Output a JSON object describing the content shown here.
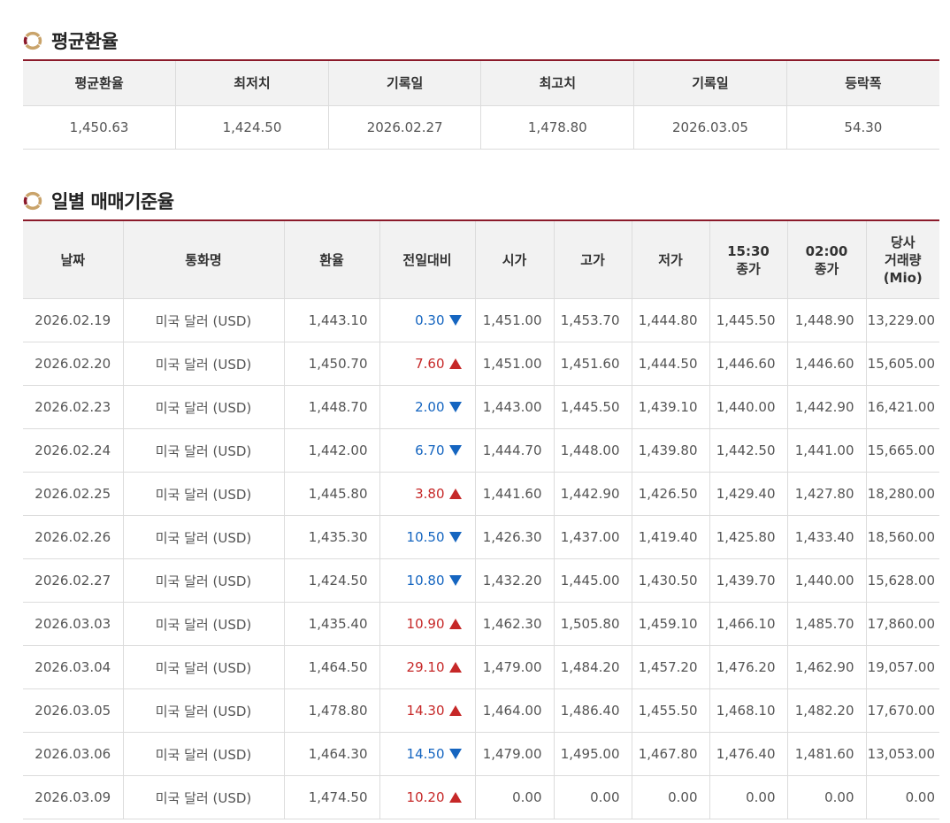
{
  "avg_section": {
    "title": "평균환율",
    "headers": [
      "평균환율",
      "최저치",
      "기록일",
      "최고치",
      "기록일",
      "등락폭"
    ],
    "values": [
      "1,450.63",
      "1,424.50",
      "2026.02.27",
      "1,478.80",
      "2026.03.05",
      "54.30"
    ]
  },
  "daily_section": {
    "title": "일별 매매기준율",
    "headers": [
      "날짜",
      "통화명",
      "환율",
      "전일대비",
      "시가",
      "고가",
      "저가",
      "15:30\n종가",
      "02:00\n종가",
      "당사\n거래량\n(Mio)"
    ],
    "rows": [
      {
        "date": "2026.02.19",
        "currency": "미국 달러 (USD)",
        "rate": "1,443.10",
        "change": "0.30",
        "dir": "down",
        "open": "1,451.00",
        "high": "1,453.70",
        "low": "1,444.80",
        "close1530": "1,445.50",
        "close0200": "1,448.90",
        "volume": "13,229.00"
      },
      {
        "date": "2026.02.20",
        "currency": "미국 달러 (USD)",
        "rate": "1,450.70",
        "change": "7.60",
        "dir": "up",
        "open": "1,451.00",
        "high": "1,451.60",
        "low": "1,444.50",
        "close1530": "1,446.60",
        "close0200": "1,446.60",
        "volume": "15,605.00"
      },
      {
        "date": "2026.02.23",
        "currency": "미국 달러 (USD)",
        "rate": "1,448.70",
        "change": "2.00",
        "dir": "down",
        "open": "1,443.00",
        "high": "1,445.50",
        "low": "1,439.10",
        "close1530": "1,440.00",
        "close0200": "1,442.90",
        "volume": "16,421.00"
      },
      {
        "date": "2026.02.24",
        "currency": "미국 달러 (USD)",
        "rate": "1,442.00",
        "change": "6.70",
        "dir": "down",
        "open": "1,444.70",
        "high": "1,448.00",
        "low": "1,439.80",
        "close1530": "1,442.50",
        "close0200": "1,441.00",
        "volume": "15,665.00"
      },
      {
        "date": "2026.02.25",
        "currency": "미국 달러 (USD)",
        "rate": "1,445.80",
        "change": "3.80",
        "dir": "up",
        "open": "1,441.60",
        "high": "1,442.90",
        "low": "1,426.50",
        "close1530": "1,429.40",
        "close0200": "1,427.80",
        "volume": "18,280.00"
      },
      {
        "date": "2026.02.26",
        "currency": "미국 달러 (USD)",
        "rate": "1,435.30",
        "change": "10.50",
        "dir": "down",
        "open": "1,426.30",
        "high": "1,437.00",
        "low": "1,419.40",
        "close1530": "1,425.80",
        "close0200": "1,433.40",
        "volume": "18,560.00"
      },
      {
        "date": "2026.02.27",
        "currency": "미국 달러 (USD)",
        "rate": "1,424.50",
        "change": "10.80",
        "dir": "down",
        "open": "1,432.20",
        "high": "1,445.00",
        "low": "1,430.50",
        "close1530": "1,439.70",
        "close0200": "1,440.00",
        "volume": "15,628.00"
      },
      {
        "date": "2026.03.03",
        "currency": "미국 달러 (USD)",
        "rate": "1,435.40",
        "change": "10.90",
        "dir": "up",
        "open": "1,462.30",
        "high": "1,505.80",
        "low": "1,459.10",
        "close1530": "1,466.10",
        "close0200": "1,485.70",
        "volume": "17,860.00"
      },
      {
        "date": "2026.03.04",
        "currency": "미국 달러 (USD)",
        "rate": "1,464.50",
        "change": "29.10",
        "dir": "up",
        "open": "1,479.00",
        "high": "1,484.20",
        "low": "1,457.20",
        "close1530": "1,476.20",
        "close0200": "1,462.90",
        "volume": "19,057.00"
      },
      {
        "date": "2026.03.05",
        "currency": "미국 달러 (USD)",
        "rate": "1,478.80",
        "change": "14.30",
        "dir": "up",
        "open": "1,464.00",
        "high": "1,486.40",
        "low": "1,455.50",
        "close1530": "1,468.10",
        "close0200": "1,482.20",
        "volume": "17,670.00"
      },
      {
        "date": "2026.03.06",
        "currency": "미국 달러 (USD)",
        "rate": "1,464.30",
        "change": "14.50",
        "dir": "down",
        "open": "1,479.00",
        "high": "1,495.00",
        "low": "1,467.80",
        "close1530": "1,476.40",
        "close0200": "1,481.60",
        "volume": "13,053.00"
      },
      {
        "date": "2026.03.09",
        "currency": "미국 달러 (USD)",
        "rate": "1,474.50",
        "change": "10.20",
        "dir": "up",
        "open": "0.00",
        "high": "0.00",
        "low": "0.00",
        "close1530": "0.00",
        "close0200": "0.00",
        "volume": "0.00"
      }
    ]
  },
  "colors": {
    "accent_border": "#8b1a2a",
    "header_bg": "#f2f2f2",
    "down": "#1565c0",
    "up": "#c62828"
  },
  "icons": {
    "section": "ring-bullet-icon",
    "down": "triangle-down-icon",
    "up": "triangle-up-icon"
  }
}
